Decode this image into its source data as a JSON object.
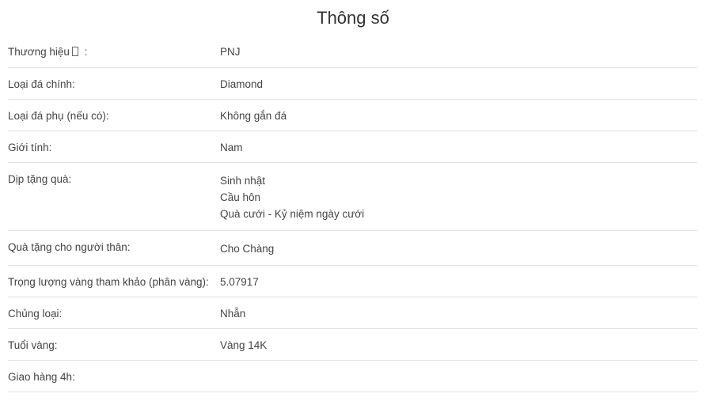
{
  "title": "Thông số",
  "specs": {
    "brand": {
      "label_text": "Thương hiệu",
      "label_suffix": " :",
      "value": "PNJ"
    },
    "main_stone": {
      "label": "Loại đá chính:",
      "value": "Diamond"
    },
    "side_stone": {
      "label": "Loại đá phụ (nếu có):",
      "value": "Không gắn đá"
    },
    "gender": {
      "label": "Giới tính:",
      "value": "Nam"
    },
    "occasion": {
      "label": "Dịp tặng quà:",
      "values": [
        "Sinh nhật",
        "Cầu hôn",
        "Quà cưới - Kỷ niệm ngày cưới"
      ]
    },
    "gift_for": {
      "label": "Quà tặng cho người thân:",
      "value": "Cho Chàng"
    },
    "gold_weight": {
      "label": "Trọng lượng vàng tham khảo (phân vàng):",
      "value": "5.07917"
    },
    "category": {
      "label": "Chủng loại:",
      "value": "Nhẫn"
    },
    "gold_purity": {
      "label": "Tuổi vàng:",
      "value": "Vàng 14K"
    },
    "delivery_4h": {
      "label": "Giao hàng 4h:",
      "value": ""
    }
  }
}
